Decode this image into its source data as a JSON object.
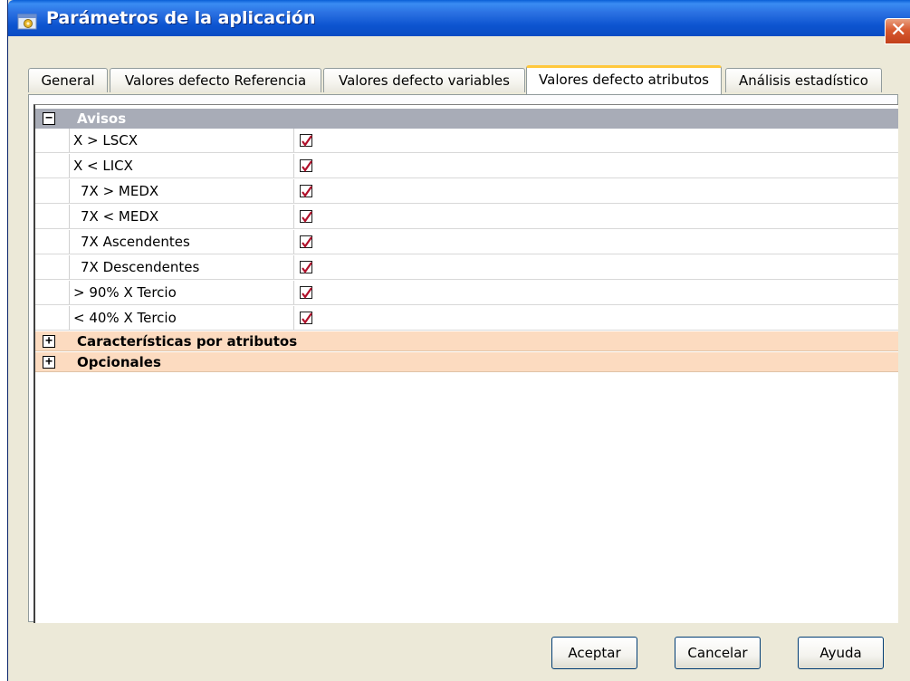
{
  "window": {
    "title": "Parámetros de la aplicación",
    "close_glyph": "✕"
  },
  "tabs": [
    {
      "label": "General",
      "active": false
    },
    {
      "label": "Valores defecto Referencia",
      "active": false
    },
    {
      "label": "Valores defecto variables",
      "active": false
    },
    {
      "label": "Valores defecto atributos",
      "active": true
    },
    {
      "label": "Análisis estadístico",
      "active": false
    }
  ],
  "grid": {
    "categories": [
      {
        "label": "Avisos",
        "expanded": true,
        "toggle": "−",
        "properties": [
          {
            "name": "X > LSCX",
            "checked": true
          },
          {
            "name": "X < LICX",
            "checked": true
          },
          {
            "name": "7X > MEDX",
            "checked": true
          },
          {
            "name": "7X < MEDX",
            "checked": true
          },
          {
            "name": "7X Ascendentes",
            "checked": true
          },
          {
            "name": "7X Descendentes",
            "checked": true
          },
          {
            "name": "> 90% X Tercio",
            "checked": true
          },
          {
            "name": "< 40% X Tercio",
            "checked": true
          }
        ]
      },
      {
        "label": "Características por atributos",
        "expanded": false,
        "toggle": "+"
      },
      {
        "label": "Opcionales",
        "expanded": false,
        "toggle": "+"
      }
    ]
  },
  "buttons": {
    "accept": "Aceptar",
    "cancel": "Cancelar",
    "help": "Ayuda"
  },
  "colors": {
    "titlebar": "#0a4cc4",
    "category_header": "#a8acb7",
    "category_collapsed": "#fcdbc0",
    "check_mark": "#b0102a",
    "active_tab_accent": "#ffc83c"
  },
  "icons": {
    "app": "app-settings-icon",
    "close": "close-icon",
    "checkbox": "checkmark-icon"
  }
}
